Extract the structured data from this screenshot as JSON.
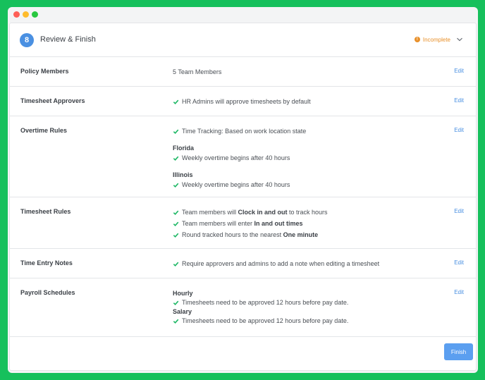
{
  "header": {
    "step_number": "8",
    "title": "Review & Finish",
    "status": "Incomplete"
  },
  "rows": [
    {
      "label": "Policy Members",
      "edit": "Edit",
      "text": "5 Team Members"
    },
    {
      "label": "Timesheet Approvers",
      "edit": "Edit",
      "items": [
        "HR Admins will approve timesheets by default"
      ]
    },
    {
      "label": "Overtime Rules",
      "edit": "Edit",
      "general": "Time Tracking: Based on work location state",
      "states": [
        {
          "name": "Florida",
          "rule": "Weekly overtime begins after 40 hours"
        },
        {
          "name": "Illinois",
          "rule": "Weekly overtime begins after 40 hours"
        }
      ]
    },
    {
      "label": "Timesheet Rules",
      "edit": "Edit",
      "items": [
        {
          "pre": "Team members will ",
          "bold": "Clock in and out",
          "post": " to track hours"
        },
        {
          "pre": "Team members will enter ",
          "bold": "In and out times",
          "post": ""
        },
        {
          "pre": "Round tracked hours to the nearest ",
          "bold": "One minute",
          "post": ""
        }
      ]
    },
    {
      "label": "Time Entry Notes",
      "edit": "Edit",
      "items": [
        "Require approvers and admins to add a note when editing a timesheet"
      ]
    },
    {
      "label": "Payroll Schedules",
      "edit": "Edit",
      "schedules": [
        {
          "name": "Hourly",
          "rule": "Timesheets need to be approved 12 hours before pay date."
        },
        {
          "name": "Salary",
          "rule": "Timesheets need to be approved 12 hours before pay date."
        }
      ]
    }
  ],
  "footer": {
    "finish_label": "Finish"
  },
  "colors": {
    "background": "#16c05c",
    "accent": "#4a90e2",
    "check": "#1fb866",
    "warning": "#e8902a"
  },
  "icons": {
    "check": "check-icon",
    "warning": "warning-icon",
    "chevron": "chevron-down-icon"
  }
}
